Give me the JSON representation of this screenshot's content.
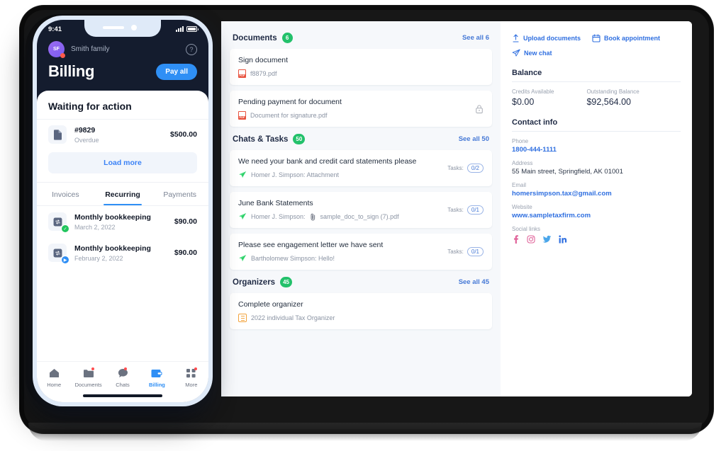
{
  "phone": {
    "status": {
      "time": "9:41",
      "signal_icon": "signal-bars-icon",
      "battery_icon": "battery-icon"
    },
    "header": {
      "avatar_initials": "SF",
      "account_name": "Smith family",
      "help_icon": "help-circle-icon",
      "title": "Billing",
      "pay_all_label": "Pay all"
    },
    "sheet_title": "Waiting for action",
    "waiting_invoice": {
      "icon": "document-icon",
      "number": "#9829",
      "status": "Overdue",
      "amount": "$500.00"
    },
    "load_more_label": "Load more",
    "tabs": [
      {
        "label": "Invoices",
        "active": false
      },
      {
        "label": "Recurring",
        "active": true
      },
      {
        "label": "Payments",
        "active": false
      }
    ],
    "recurring": [
      {
        "icon": "recurring-icon",
        "status_icon": "check-badge",
        "name": "Monthly bookkeeping",
        "date": "March 2, 2022",
        "amount": "$90.00"
      },
      {
        "icon": "recurring-icon",
        "status_icon": "play-badge",
        "name": "Monthly bookkeeping",
        "date": "February 2, 2022",
        "amount": "$90.00"
      }
    ],
    "tabbar": [
      {
        "icon": "home-icon",
        "label": "Home",
        "active": false,
        "dot": false
      },
      {
        "icon": "folder-icon",
        "label": "Documents",
        "active": false,
        "dot": true
      },
      {
        "icon": "chat-bubble-icon",
        "label": "Chats",
        "active": false,
        "dot": true
      },
      {
        "icon": "wallet-icon",
        "label": "Billing",
        "active": true,
        "dot": false
      },
      {
        "icon": "grid-plus-icon",
        "label": "More",
        "active": false,
        "dot": true
      }
    ]
  },
  "desktop": {
    "sections": [
      {
        "title": "Documents",
        "count": "6",
        "see_all": "See all 6",
        "items": [
          {
            "title": "Sign document",
            "file_icon": "pdf-icon",
            "file": "f8879.pdf",
            "trailing": ""
          },
          {
            "title": "Pending payment for document",
            "file_icon": "pdf-icon",
            "file": "Document for signature.pdf",
            "trailing": "lock-icon"
          }
        ]
      },
      {
        "title": "Chats & Tasks",
        "count": "50",
        "see_all": "See all 50",
        "items": [
          {
            "title": "We need your bank and credit card statements please",
            "file_icon": "send-icon",
            "file": "Homer J. Simpson: Attachment",
            "tasks_label": "Tasks:",
            "tasks": "0/2"
          },
          {
            "title": "June Bank Statements",
            "file_icon": "send-icon",
            "file": "Homer J. Simpson:",
            "attachment_icon": "paperclip-icon",
            "attachment": "sample_doc_to_sign (7).pdf",
            "tasks_label": "Tasks:",
            "tasks": "0/1"
          },
          {
            "title": "Please see engagement letter we have sent",
            "file_icon": "send-icon",
            "file": "Bartholomew Simpson: Hello!",
            "tasks_label": "Tasks:",
            "tasks": "0/1"
          }
        ]
      },
      {
        "title": "Organizers",
        "count": "45",
        "see_all": "See all 45",
        "items": [
          {
            "title": "Complete organizer",
            "file_icon": "organizer-icon",
            "file": "2022 individual Tax Organizer",
            "trailing": ""
          }
        ]
      }
    ],
    "sidebar": {
      "quick_links": [
        {
          "icon": "upload-icon",
          "label": "Upload documents"
        },
        {
          "icon": "calendar-icon",
          "label": "Book appointment"
        },
        {
          "icon": "send-icon",
          "label": "New chat"
        }
      ],
      "balance_heading": "Balance",
      "balance": [
        {
          "label": "Credits Available",
          "value": "$0.00"
        },
        {
          "label": "Outstanding Balance",
          "value": "$92,564.00"
        }
      ],
      "contact_heading": "Contact info",
      "contact": [
        {
          "label": "Phone",
          "value": "1800-444-1111",
          "link": true
        },
        {
          "label": "Address",
          "value": "55 Main street, Springfield, AK 01001",
          "link": false
        },
        {
          "label": "Email",
          "value": "homersimpson.tax@gmail.com",
          "link": true
        },
        {
          "label": "Website",
          "value": "www.sampletaxfirm.com",
          "link": true
        }
      ],
      "social_label": "Social links",
      "social": [
        {
          "icon": "facebook-icon",
          "color": "#e0639a"
        },
        {
          "icon": "instagram-icon",
          "color": "#e0639a"
        },
        {
          "icon": "twitter-icon",
          "color": "#4aa6ea"
        },
        {
          "icon": "linkedin-icon",
          "color": "#2f6fe0"
        }
      ]
    }
  },
  "colors": {
    "accent_blue": "#2f8ff5",
    "link_blue": "#2f6fe0",
    "badge_green": "#23c16b",
    "pdf_red": "#e8533f",
    "phone_dark": "#141c2e"
  }
}
